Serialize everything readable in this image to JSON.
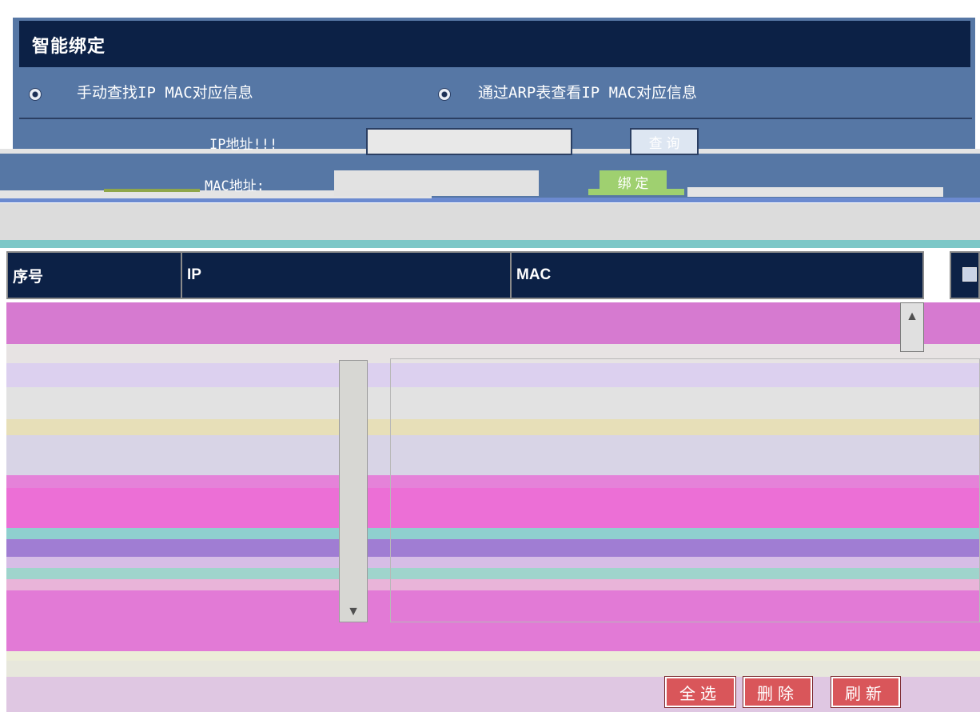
{
  "panel": {
    "title": "智能绑定",
    "radio_manual": "手动查找IP MAC对应信息",
    "radio_arp": "通过ARP表查看IP MAC对应信息"
  },
  "form": {
    "ip_label": "IP地址!!!",
    "ip_value": "",
    "query_label": "查 询",
    "mac_label": "MAC地址:",
    "mac_value": "",
    "bind_label": "绑 定"
  },
  "table": {
    "columns": [
      "序号",
      "IP",
      "MAC"
    ],
    "scroll_up_icon": "arrow-up-icon",
    "scroll_down_icon": "arrow-down-icon"
  },
  "footer": {
    "select_all": "全选",
    "delete": "删除",
    "refresh": "刷新"
  },
  "colors": {
    "panel": "#5677a5",
    "header": "#0c2146",
    "body_magenta": "#d67ad0",
    "button_red": "#d9565a"
  }
}
